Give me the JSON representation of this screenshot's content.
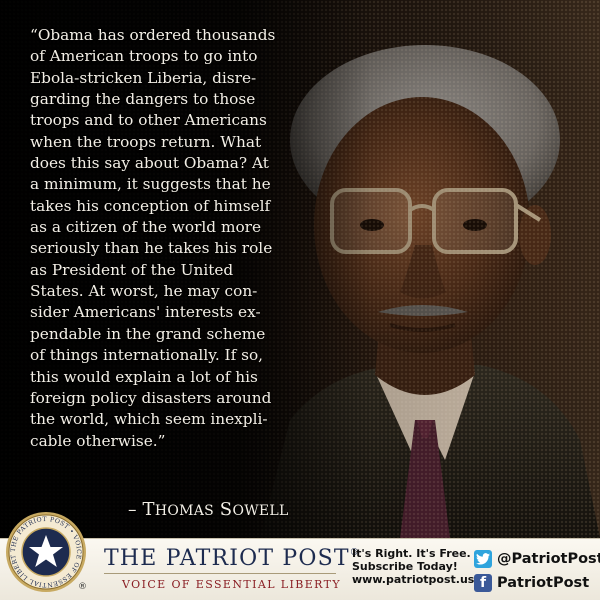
{
  "quote": {
    "lines": [
      "“Obama has ordered thousands",
      "of American troops to go into",
      "Ebola-stricken Liberia, disre-",
      "garding the dangers to those",
      "troops and to other Americans",
      "when the troops return. What",
      "does this say about Obama? At",
      "a minimum, it suggests that he",
      "takes his conception of himself",
      "as a citizen of the world more",
      "seriously than he takes his role",
      "as President of the United",
      "States. At worst, he may con-",
      "sider Americans' interests ex-",
      "pendable in the grand scheme",
      "of things internationally. If so,",
      "this would explain a lot of his",
      "foreign policy disasters around",
      "the world, which seem inexpli-",
      "cable otherwise.”"
    ],
    "attribution_dash": "–",
    "attribution_first_initial": "T",
    "attribution_first_rest": "HOMAS",
    "attribution_last_initial": "S",
    "attribution_last_rest": "OWELL"
  },
  "footer": {
    "brand_name": "THE PATRIOT POST",
    "brand_mark": "®",
    "tagline": "VOICE OF ESSENTIAL LIBERTY",
    "seal_text": "THE PATRIOT POST • VOICE OF ESSENTIAL LIBERTY •",
    "seal_registered": "®",
    "cta_lines": [
      "It's Right. It's Free.",
      "Subscribe Today!",
      "www.patriotpost.us"
    ],
    "twitter_handle": "@PatriotPost",
    "facebook_page": "PatriotPost",
    "twitter_icon": "twitter-bird-icon",
    "facebook_icon": "facebook-f-icon"
  },
  "colors": {
    "brand_navy": "#1d2b4f",
    "tagline_red": "#8a1e24",
    "twitter_blue": "#2fa4dd",
    "facebook_blue": "#3b5998",
    "quote_text": "#f3efe6"
  }
}
